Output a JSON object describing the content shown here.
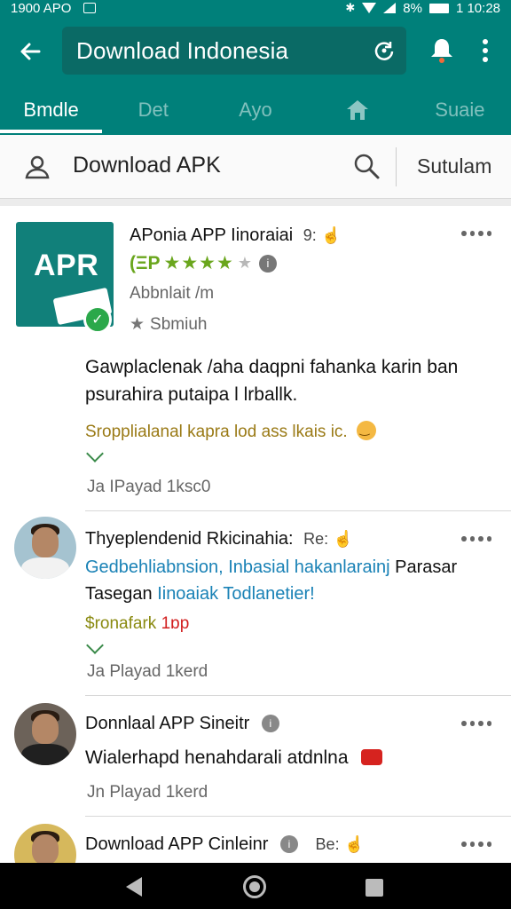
{
  "status_bar": {
    "left_text": "1900 APO",
    "battery": "8%",
    "time": "1 10:28"
  },
  "header": {
    "search_title": "Download Indonesia",
    "tabs": [
      {
        "label": "Bmdle",
        "active": true
      },
      {
        "label": "Det",
        "active": false
      },
      {
        "label": "Ayo",
        "active": false
      },
      {
        "label": "",
        "icon": "home-icon",
        "active": false
      },
      {
        "label": "Suaie",
        "active": false
      }
    ]
  },
  "subheader": {
    "title": "Download APK",
    "right_label": "Sutulam"
  },
  "feed": {
    "card1": {
      "tile_text": "APR",
      "title": "AРonia APP Iinoraiai",
      "title_suffix": "9:",
      "rating_prefix": "(ΞP",
      "stars": "★★★★",
      "rating": 3.5,
      "sub_line": "Abbnlait /m",
      "meta_line": "Sbmiuh",
      "body": "Gawplaclenak /aha daqpni fahanka karin ban psurahira putaipa l lrballk.",
      "promo": "Sropplialanal kapra lod ass lkais ic.",
      "reactions": "Ja  IPayad 1ksc0"
    },
    "card2": {
      "title": "Thyeplendenid Rkicinahia:",
      "title_suffix": "Re:",
      "blue_line1": "Gedbehliabnsion, Inbasial hakanlarainj",
      "blue_line1_end": "Parasar",
      "blue_line2_dark": "Tasegan",
      "blue_line2": "Iinoaiak Todlanetier!",
      "promo_green": "$ronafark",
      "promo_red": "1ɒp",
      "reactions": "Ja  Playad 1kerd"
    },
    "card3": {
      "title": "Donnlaal APP Sineitr",
      "body": "Wialerhapd henahdarali atdnlna",
      "reactions": "Jn  Playad 1kerd"
    },
    "card4": {
      "title": "Download APP Cinleinr",
      "title_suffix": "Be:"
    }
  },
  "colors": {
    "brand_teal": "#00807a",
    "rating_green": "#6aa61d",
    "link_blue": "#1a82b6",
    "promo_gold": "#9a7a16"
  },
  "icons": [
    "back-arrow-icon",
    "refresh-icon",
    "bell-icon",
    "more-vert-icon",
    "home-icon",
    "user-icon",
    "search-icon",
    "check-icon",
    "info-icon",
    "gift-icon",
    "smile-emoji-icon"
  ]
}
